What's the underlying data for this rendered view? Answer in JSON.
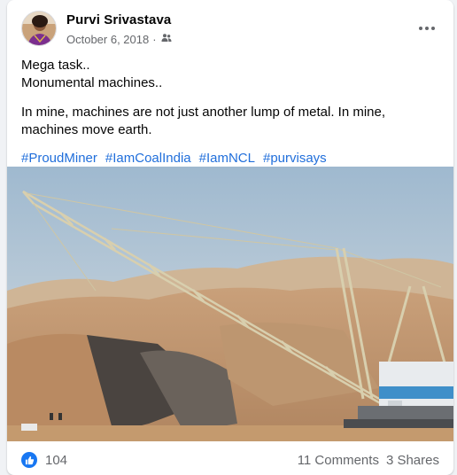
{
  "post": {
    "author": "Purvi Srivastava",
    "date": "October 6, 2018",
    "privacy_icon": "friends-icon",
    "more_icon": "more-options-icon",
    "lines": [
      "Mega task..",
      "Monumental machines.."
    ],
    "paragraph": "In mine, machines are not just another lump of metal. In mine, machines move earth.",
    "hashtags": [
      "#ProudMiner",
      "#IamCoalIndia",
      "#IamNCL",
      "#purvisays"
    ],
    "image_icon": "dragline-excavator-photo"
  },
  "reactions": {
    "icon": "like-icon",
    "count": "104",
    "comments": "11 Comments",
    "shares": "3 Shares"
  },
  "colors": {
    "link": "#216fdb",
    "like": "#1877f2",
    "meta": "#65676b"
  }
}
